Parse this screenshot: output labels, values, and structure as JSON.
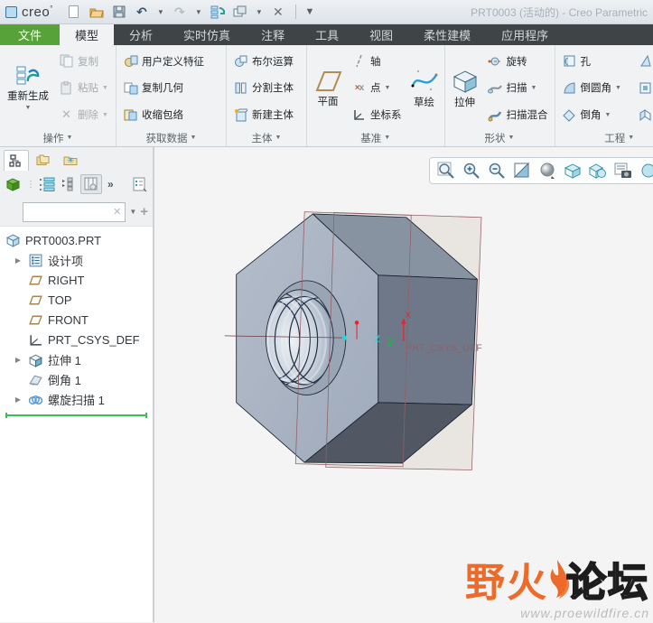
{
  "window": {
    "logo": "creo",
    "title": "PRT0003 (活动的) - Creo Parametric"
  },
  "quick_toolbar": {
    "icons": [
      "new-file",
      "open-folder",
      "save",
      "undo",
      "undo-dropdown",
      "redo",
      "redo-dropdown",
      "regenerate-manager",
      "window-switch",
      "window-dropdown",
      "close-window",
      "more-commands"
    ]
  },
  "ribbon": {
    "tabs": [
      "文件",
      "模型",
      "分析",
      "实时仿真",
      "注释",
      "工具",
      "视图",
      "柔性建模",
      "应用程序"
    ],
    "active_tab": "模型",
    "groups": [
      {
        "label": "操作",
        "buttons": [
          {
            "label": "重新生成"
          },
          {
            "label": "复制"
          },
          {
            "label": "粘贴"
          },
          {
            "label": "删除"
          }
        ]
      },
      {
        "label": "获取数据",
        "buttons": [
          {
            "label": "用户定义特征"
          },
          {
            "label": "复制几何"
          },
          {
            "label": "收缩包络"
          }
        ]
      },
      {
        "label": "主体",
        "buttons": [
          {
            "label": "布尔运算"
          },
          {
            "label": "分割主体"
          },
          {
            "label": "新建主体"
          }
        ]
      },
      {
        "label": "基准",
        "buttons": [
          {
            "label": "平面"
          },
          {
            "label": "轴"
          },
          {
            "label": "点"
          },
          {
            "label": "坐标系"
          },
          {
            "label": "草绘"
          }
        ]
      },
      {
        "label": "形状",
        "buttons": [
          {
            "label": "拉伸"
          },
          {
            "label": "旋转"
          },
          {
            "label": "扫描"
          },
          {
            "label": "扫描混合"
          }
        ]
      },
      {
        "label": "工程",
        "buttons": [
          {
            "label": "孔"
          },
          {
            "label": "倒圆角"
          },
          {
            "label": "倒角"
          },
          {
            "label": "拔模"
          },
          {
            "label": "壳"
          },
          {
            "label": "筋"
          }
        ]
      }
    ]
  },
  "navigator": {
    "tabs": [
      "model-tree",
      "folder-browser",
      "favorites"
    ],
    "toolbar_icons": [
      "show-part",
      "tree-filters",
      "tree-columns",
      "settings-columns",
      "expand-more",
      "tree-options"
    ],
    "filter": {
      "value": "",
      "placeholder": ""
    }
  },
  "tree": {
    "items": [
      {
        "label": "PRT0003.PRT",
        "icon": "part-icon",
        "expandable": false
      },
      {
        "label": "设计项",
        "icon": "design-items-icon",
        "expandable": true
      },
      {
        "label": "RIGHT",
        "icon": "datum-plane-icon",
        "expandable": false
      },
      {
        "label": "TOP",
        "icon": "datum-plane-icon",
        "expandable": false
      },
      {
        "label": "FRONT",
        "icon": "datum-plane-icon",
        "expandable": false
      },
      {
        "label": "PRT_CSYS_DEF",
        "icon": "csys-icon",
        "expandable": false
      },
      {
        "label": "拉伸 1",
        "icon": "extrude-icon",
        "expandable": true
      },
      {
        "label": "倒角 1",
        "icon": "chamfer-icon",
        "expandable": false
      },
      {
        "label": "螺旋扫描 1",
        "icon": "helical-sweep-icon",
        "expandable": true
      }
    ]
  },
  "viewport": {
    "toolbar_icons": [
      "zoom-fit",
      "zoom-in",
      "zoom-out",
      "repaint",
      "shading-style",
      "saved-views",
      "display-style",
      "annotations",
      "component-display"
    ],
    "axis": {
      "x": "X",
      "y": "Y",
      "z": "Z"
    },
    "csys_label": "PRT_CSYS_DEF",
    "model": "hex-nut-with-threaded-hole"
  },
  "watermark": {
    "brand_left": "野火",
    "brand_right": "论坛",
    "url": "www.proewildfire.cn"
  },
  "colors": {
    "file_tab_green": "#57a339",
    "ribbon_bar_dark": "#3f4446",
    "insertion_line_green": "#3fbe55",
    "datum_maroon": "#926068",
    "axis_x_red": "#e8262a",
    "axis_y_green": "#24b24a",
    "axis_z_cyan": "#17dddd",
    "watermark_orange": "#ed6b2a",
    "nut_front_face": "#a9b3c1",
    "nut_right_face": "#6f7888",
    "nut_bottom_face": "#515866"
  }
}
